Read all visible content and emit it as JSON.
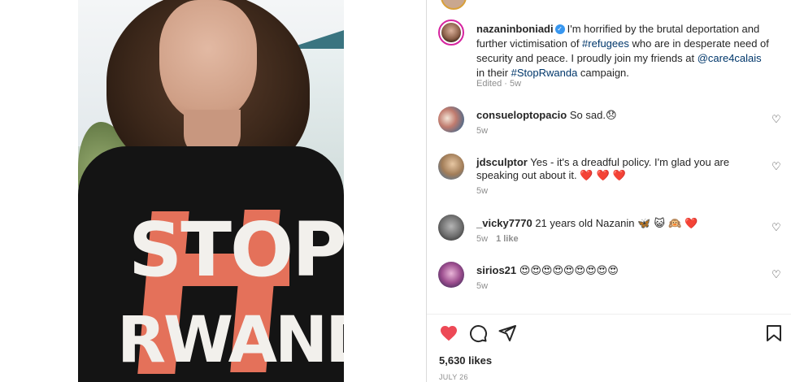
{
  "post": {
    "username": "nazaninboniadi",
    "caption_intro": "I'm horrified by the brutal deportation and further victimisation of ",
    "hashtag_refugees": "#refugees",
    "caption_mid": " who are in desperate need of security and peace. I proudly join my friends at ",
    "mention": "@care4calais",
    "caption_mid2": " in their ",
    "hashtag_campaign": "#StopRwanda",
    "caption_end": " campaign.",
    "meta": "Edited · 5w",
    "shirt_line1": "STOP",
    "shirt_line2": "RWANDA"
  },
  "comments": [
    {
      "username": "consueloptopacio",
      "text": "So sad.",
      "emoji": "😞",
      "time": "5w",
      "likes": ""
    },
    {
      "username": "jdsculptor",
      "text": "Yes - it's a dreadful policy. I'm glad you are speaking out about it.",
      "emoji": "❤️ ❤️ ❤️",
      "time": "5w",
      "likes": ""
    },
    {
      "username": "_vicky7770",
      "text": "21 years old Nazanin",
      "emoji": "🦋 😺 🙉 ❤️",
      "time": "5w",
      "likes": "1 like"
    },
    {
      "username": "sirios21",
      "text": "",
      "emoji": "😍😍😍😍😍😍😍😍😍",
      "time": "5w",
      "likes": ""
    }
  ],
  "footer": {
    "likes": "5,630 likes",
    "date": "JULY 26"
  },
  "icons": {
    "like": "heart-filled-icon",
    "comment": "comment-icon",
    "share": "paper-plane-icon",
    "save": "bookmark-icon",
    "comment_like": "heart-outline-icon"
  },
  "colors": {
    "like_red": "#ed4956",
    "link_blue": "#00376b",
    "verified_blue": "#3897f0",
    "meta_gray": "#8e8e8e"
  }
}
